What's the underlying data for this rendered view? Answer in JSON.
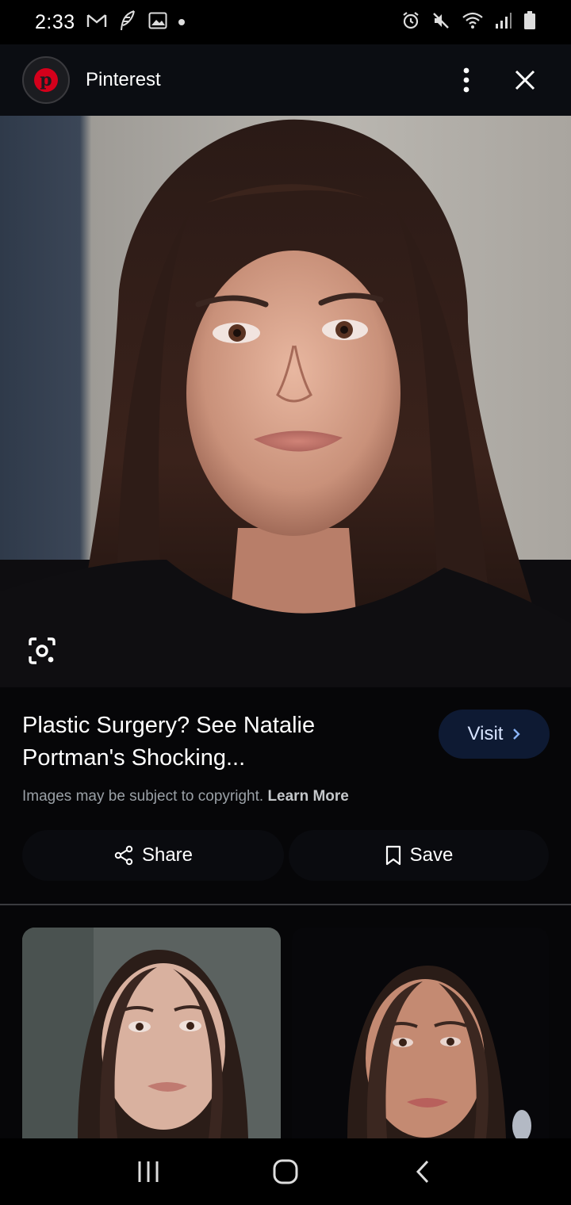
{
  "status_bar": {
    "time": "2:33",
    "left_icons": [
      "gmail-icon",
      "feather-icon",
      "gallery-icon",
      "notification-dot"
    ],
    "right_icons": [
      "alarm-icon",
      "mute-icon",
      "wifi-icon",
      "signal-icon",
      "battery-icon"
    ]
  },
  "header": {
    "logo_letter": "p",
    "site_name": "Pinterest",
    "brand_color": "#d4001b"
  },
  "main": {
    "image_alt": "Photo of a young woman with long dark brown hair against a stone wall",
    "lens_icon": "google-lens-icon"
  },
  "info": {
    "title": "Plastic Surgery? See Natalie Portman's Shocking...",
    "visit_label": "Visit",
    "copyright_text": "Images may be subject to copyright.",
    "learn_more": "Learn More",
    "share_label": "Share",
    "save_label": "Save"
  },
  "related": {
    "items": [
      {
        "alt": "Related image of a young woman with dark hair, grey background"
      },
      {
        "alt": "Related image of a young woman with dark hair, dark background"
      }
    ]
  },
  "nav": {
    "icons": [
      "recent-apps-icon",
      "home-icon",
      "back-icon"
    ]
  }
}
